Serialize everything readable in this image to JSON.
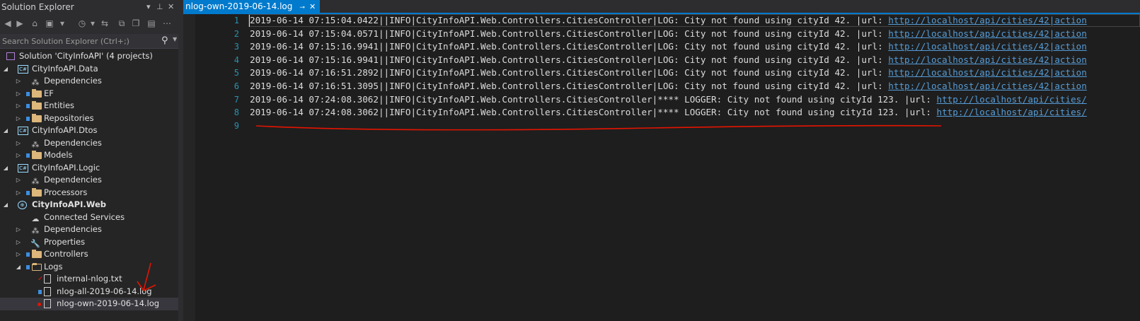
{
  "solution_explorer": {
    "title": "Solution Explorer",
    "search_placeholder": "Search Solution Explorer (Ctrl+;)",
    "tree": [
      {
        "label": "Solution 'CityInfoAPI' (4 projects)",
        "type": "solution"
      },
      {
        "label": "CityInfoAPI.Data",
        "type": "project"
      },
      {
        "label": "Dependencies",
        "type": "deps"
      },
      {
        "label": "EF",
        "type": "folder"
      },
      {
        "label": "Entities",
        "type": "folder"
      },
      {
        "label": "Repositories",
        "type": "folder"
      },
      {
        "label": "CityInfoAPI.Dtos",
        "type": "project"
      },
      {
        "label": "Dependencies",
        "type": "deps"
      },
      {
        "label": "Models",
        "type": "folder"
      },
      {
        "label": "CityInfoAPI.Logic",
        "type": "project"
      },
      {
        "label": "Dependencies",
        "type": "deps"
      },
      {
        "label": "Processors",
        "type": "folder"
      },
      {
        "label": "CityInfoAPI.Web",
        "type": "webproject"
      },
      {
        "label": "Connected Services",
        "type": "service"
      },
      {
        "label": "Dependencies",
        "type": "deps"
      },
      {
        "label": "Properties",
        "type": "properties"
      },
      {
        "label": "Controllers",
        "type": "folder"
      },
      {
        "label": "Logs",
        "type": "folder"
      },
      {
        "label": "internal-nlog.txt",
        "type": "file"
      },
      {
        "label": "nlog-all-2019-06-14.log",
        "type": "file"
      },
      {
        "label": "nlog-own-2019-06-14.log",
        "type": "file"
      }
    ]
  },
  "editor": {
    "tab_label": "nlog-own-2019-06-14.log",
    "lines": [
      {
        "num": "1",
        "text": "2019-06-14 07:15:04.0422||INFO|CityInfoAPI.Web.Controllers.CitiesController|LOG: City not found using cityId 42. |url: ",
        "link": "http://localhost/api/cities/42|action"
      },
      {
        "num": "2",
        "text": "2019-06-14 07:15:04.0571||INFO|CityInfoAPI.Web.Controllers.CitiesController|LOG: City not found using cityId 42. |url: ",
        "link": "http://localhost/api/cities/42|action"
      },
      {
        "num": "3",
        "text": "2019-06-14 07:15:16.9941||INFO|CityInfoAPI.Web.Controllers.CitiesController|LOG: City not found using cityId 42. |url: ",
        "link": "http://localhost/api/cities/42|action"
      },
      {
        "num": "4",
        "text": "2019-06-14 07:15:16.9941||INFO|CityInfoAPI.Web.Controllers.CitiesController|LOG: City not found using cityId 42. |url: ",
        "link": "http://localhost/api/cities/42|action"
      },
      {
        "num": "5",
        "text": "2019-06-14 07:16:51.2892||INFO|CityInfoAPI.Web.Controllers.CitiesController|LOG: City not found using cityId 42. |url: ",
        "link": "http://localhost/api/cities/42|action"
      },
      {
        "num": "6",
        "text": "2019-06-14 07:16:51.3095||INFO|CityInfoAPI.Web.Controllers.CitiesController|LOG: City not found using cityId 42. |url: ",
        "link": "http://localhost/api/cities/42|action"
      },
      {
        "num": "7",
        "text": "2019-06-14 07:24:08.3062||INFO|CityInfoAPI.Web.Controllers.CitiesController|**** LOGGER: City not found using cityId 123. |url: ",
        "link": "http://localhost/api/cities/"
      },
      {
        "num": "8",
        "text": "2019-06-14 07:24:08.3062||INFO|CityInfoAPI.Web.Controllers.CitiesController|**** LOGGER: City not found using cityId 123. |url: ",
        "link": "http://localhost/api/cities/"
      },
      {
        "num": "9",
        "text": "",
        "link": ""
      }
    ]
  },
  "colors": {
    "accent": "#007acc",
    "line_number": "#2b91af",
    "link": "#569cd6",
    "annotation": "#e51400"
  }
}
